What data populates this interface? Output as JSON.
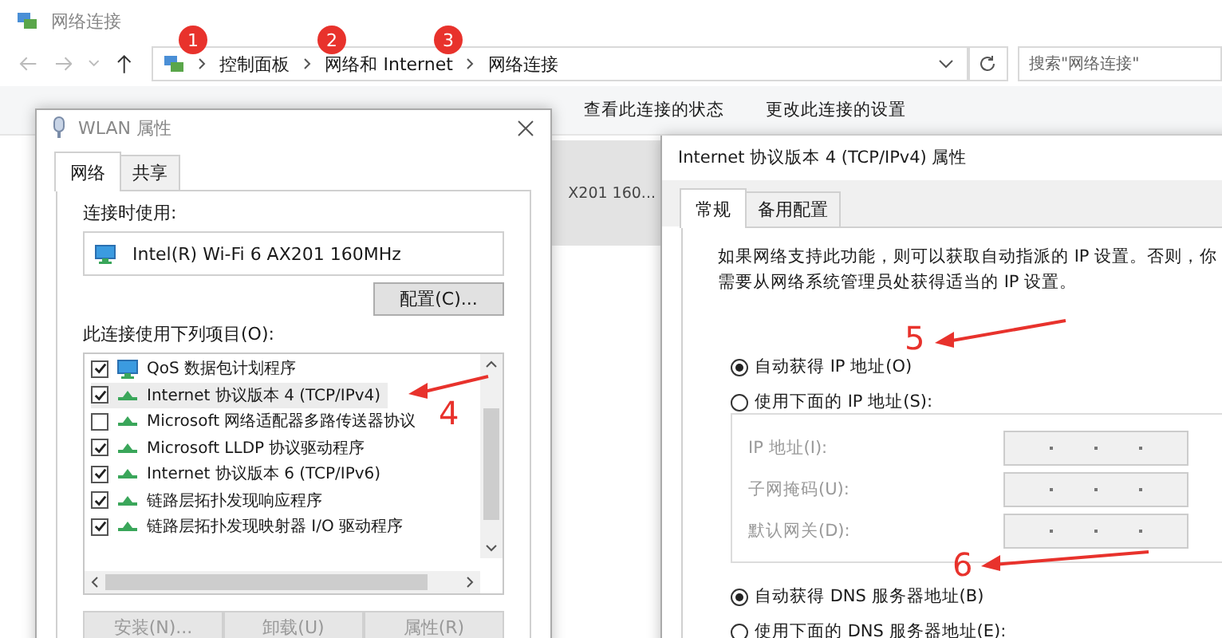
{
  "explorer": {
    "title": "网络连接",
    "breadcrumbs": [
      {
        "label": "控制面板",
        "badge": "1"
      },
      {
        "label": "网络和 Internet",
        "badge": "2"
      },
      {
        "label": "网络连接",
        "badge": "3"
      }
    ],
    "search": {
      "placeholder": "搜索\"网络连接\""
    },
    "toolbar": [
      "查看此连接的状态",
      "更改此连接的设置"
    ],
    "selected_item_text": "X201 160..."
  },
  "wlan_dialog": {
    "title": "WLAN 属性",
    "tabs": [
      {
        "label": "网络",
        "selected": true
      },
      {
        "label": "共享",
        "selected": false
      }
    ],
    "connect_using_label": "连接时使用:",
    "adapter": "Intel(R) Wi-Fi 6 AX201 160MHz",
    "configure_button": "配置(C)...",
    "items_label": "此连接使用下列项目(O):",
    "items": [
      {
        "label": "QoS 数据包计划程序",
        "kind": "service",
        "checked": true,
        "selected": false
      },
      {
        "label": "Internet 协议版本 4 (TCP/IPv4)",
        "kind": "protocol",
        "checked": true,
        "selected": true
      },
      {
        "label": "Microsoft 网络适配器多路传送器协议",
        "kind": "protocol",
        "checked": false,
        "selected": false
      },
      {
        "label": "Microsoft LLDP 协议驱动程序",
        "kind": "protocol",
        "checked": true,
        "selected": false
      },
      {
        "label": "Internet 协议版本 6 (TCP/IPv6)",
        "kind": "protocol",
        "checked": true,
        "selected": false
      },
      {
        "label": "链路层拓扑发现响应程序",
        "kind": "protocol",
        "checked": true,
        "selected": false
      },
      {
        "label": "链路层拓扑发现映射器 I/O 驱动程序",
        "kind": "protocol",
        "checked": true,
        "selected": false
      }
    ],
    "buttons": [
      {
        "label": "安装(N)...",
        "disabled": true
      },
      {
        "label": "卸载(U)",
        "disabled": true
      },
      {
        "label": "属性(R)",
        "disabled": true
      }
    ]
  },
  "ipv4_dialog": {
    "title": "Internet 协议版本 4 (TCP/IPv4) 属性",
    "tabs": [
      {
        "label": "常规",
        "selected": true
      },
      {
        "label": "备用配置",
        "selected": false
      }
    ],
    "description": "如果网络支持此功能，则可以获取自动指派的 IP 设置。否则，你需要从网络系统管理员处获得适当的 IP 设置。",
    "ip_options": [
      {
        "label": "自动获得 IP 地址(O)",
        "selected": true
      },
      {
        "label": "使用下面的 IP 地址(S):",
        "selected": false
      }
    ],
    "ip_fields": [
      {
        "label": "IP 地址(I):",
        "disabled": true
      },
      {
        "label": "子网掩码(U):",
        "disabled": true
      },
      {
        "label": "默认网关(D):",
        "disabled": true
      }
    ],
    "dns_options": [
      {
        "label": "自动获得 DNS 服务器地址(B)",
        "selected": true
      },
      {
        "label": "使用下面的 DNS 服务器地址(E):",
        "selected": false
      }
    ]
  },
  "annotations": [
    {
      "number": "4"
    },
    {
      "number": "5"
    },
    {
      "number": "6"
    }
  ]
}
